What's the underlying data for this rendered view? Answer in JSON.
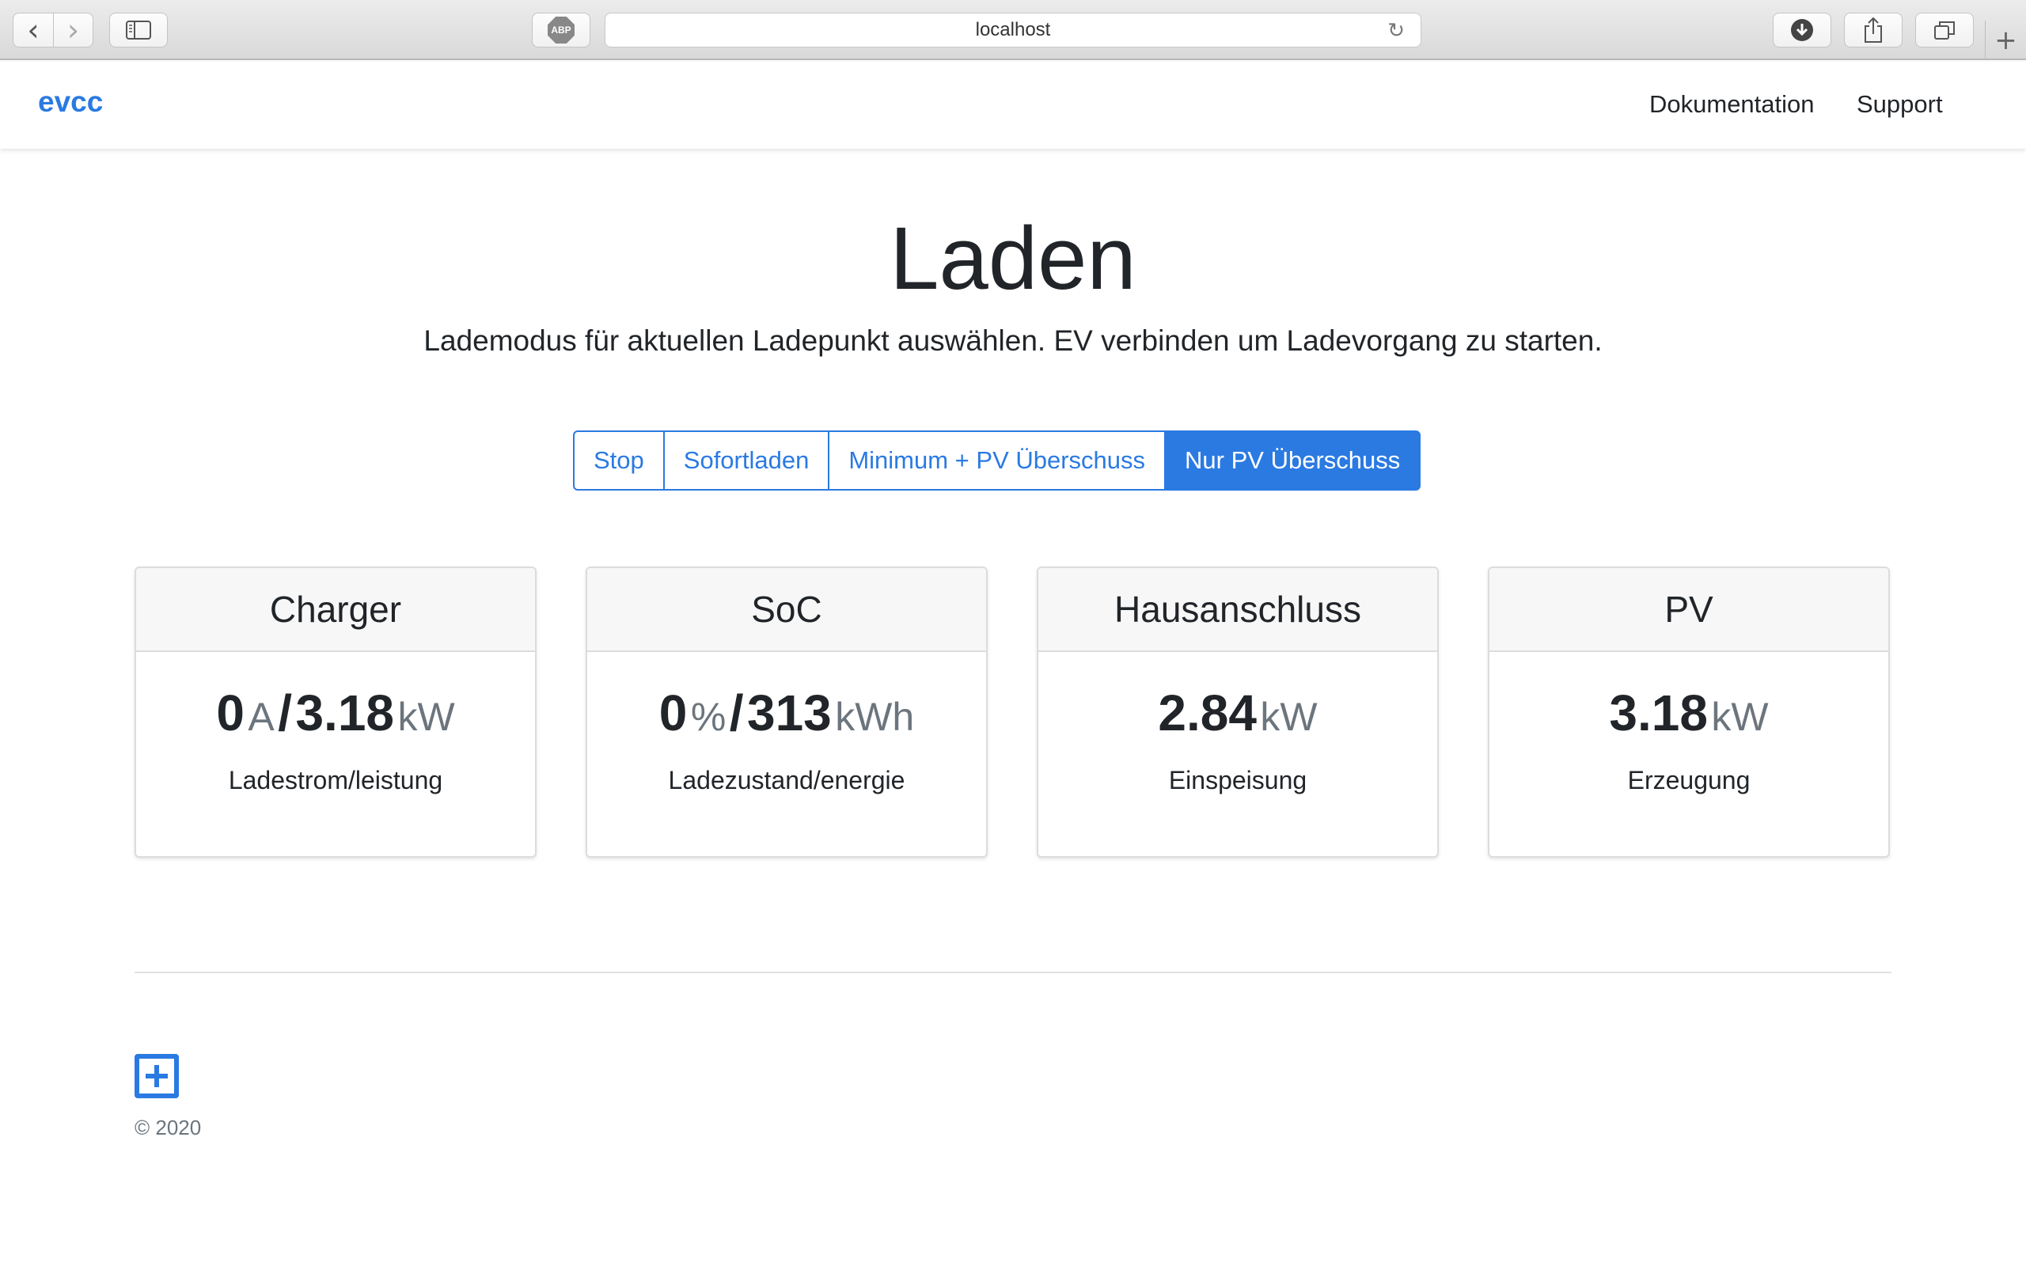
{
  "browser": {
    "url": "localhost",
    "back_icon": "‹",
    "forward_icon": "›",
    "abp_label": "ABP",
    "reload_icon": "↻",
    "download_icon": "⬇",
    "share_icon": "⇪",
    "tabs_icon": "⧉",
    "new_tab_icon": "+"
  },
  "navbar": {
    "brand": "evcc",
    "links": [
      "Dokumentation",
      "Support"
    ]
  },
  "hero": {
    "title": "Laden",
    "lead": "Lademodus für aktuellen Ladepunkt auswählen. EV verbinden um Ladevorgang zu starten."
  },
  "modes": {
    "options": [
      "Stop",
      "Sofortladen",
      "Minimum + PV Überschuss",
      "Nur PV Überschuss"
    ],
    "selected": "Nur PV Überschuss"
  },
  "cards": [
    {
      "title": "Charger",
      "value1": "0",
      "unit1": "A",
      "separator": "/",
      "value2": "3.18",
      "unit2": "kW",
      "label": "Ladestrom/leistung"
    },
    {
      "title": "SoC",
      "value1": "0",
      "unit1": "%",
      "separator": "/",
      "value2": "313",
      "unit2": "kWh",
      "label": "Ladezustand/energie"
    },
    {
      "title": "Hausanschluss",
      "value1": "2.84",
      "unit1": "kW",
      "label": "Einspeisung"
    },
    {
      "title": "PV",
      "value1": "3.18",
      "unit1": "kW",
      "label": "Erzeugung"
    }
  ],
  "footer": {
    "icon": "plus-square-icon",
    "copyright": "© 2020"
  },
  "colors": {
    "accent": "#2a7ae2",
    "muted": "#6c757d",
    "text": "#212529"
  }
}
